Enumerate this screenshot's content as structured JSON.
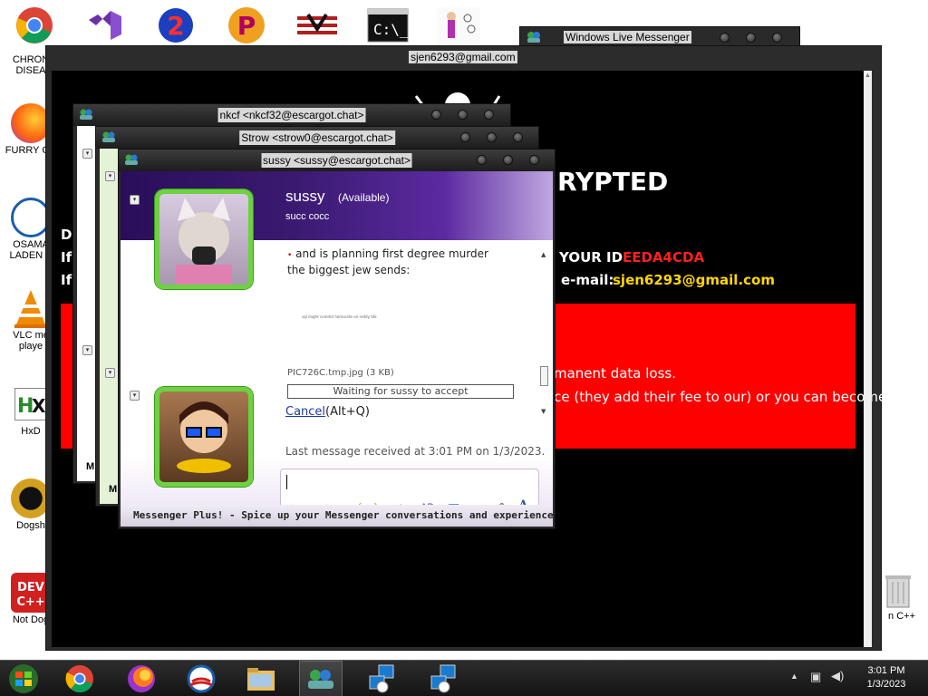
{
  "desktop": {
    "top_icons": [
      {
        "name": "chrome"
      },
      {
        "name": "visual-studio"
      },
      {
        "name": "app-2"
      },
      {
        "name": "app-p"
      },
      {
        "name": "app-flag"
      },
      {
        "name": "cmd"
      },
      {
        "name": "app-figure"
      }
    ],
    "left_icons": [
      {
        "label": "CHRON\nDISEA"
      },
      {
        "label": "FURRY CU"
      },
      {
        "label": "OSAMA\nLADEN E"
      },
      {
        "label": "VLC me\nplaye"
      },
      {
        "label": "HxD"
      },
      {
        "label": "Dogsh"
      },
      {
        "label": "Not Dog"
      }
    ],
    "right_icons": [
      {
        "label": "n C++"
      }
    ]
  },
  "wlm_window": {
    "title": "Windows Live Messenger"
  },
  "ransom_window": {
    "title": "sjen6293@gmail.com",
    "heading_fragment": "RYPTED",
    "side_letters": [
      "De",
      "If",
      "If"
    ],
    "id_label": "YOUR ID",
    "id_value": "EEDA4CDA",
    "email_label": "e-mail:",
    "email_value": "sjen6293@gmail.com",
    "red_line1": "manent data loss.",
    "red_line2": "ice (they add their fee to our) or you can become"
  },
  "chat_windows": [
    {
      "title": "nkcf <nkcf32@escargot.chat>",
      "footer_fragment": "M"
    },
    {
      "title": "Strow <strow0@escargot.chat>",
      "footer_fragment": "M"
    }
  ],
  "main_chat": {
    "title": "sussy <sussy@escargot.chat>",
    "contact_name": "sussy",
    "contact_status": "(Available)",
    "contact_psm": "succ cocc",
    "messages": [
      "and is planning first degree murder",
      "the biggest jew sends:"
    ],
    "tiny_image_caption": "sql might commit homocide on reddy tdk",
    "file_name": "PIC726C.tmp.jpg (3 KB)",
    "transfer_status": "Waiting for sussy to accept",
    "cancel_link": "Cancel",
    "cancel_shortcut": "(Alt+Q)",
    "last_message": "Last message received at 3:01 PM on 1/3/2023.",
    "input_value": "",
    "footer": "Messenger Plus! - Spice up your Messenger conversations and experience w..."
  },
  "taskbar": {
    "time": "3:01 PM",
    "date": "1/3/2023"
  },
  "colors": {
    "accent_red": "#ff2020",
    "email_yellow": "#ffd700",
    "msn_purple": "#3a1a70"
  }
}
